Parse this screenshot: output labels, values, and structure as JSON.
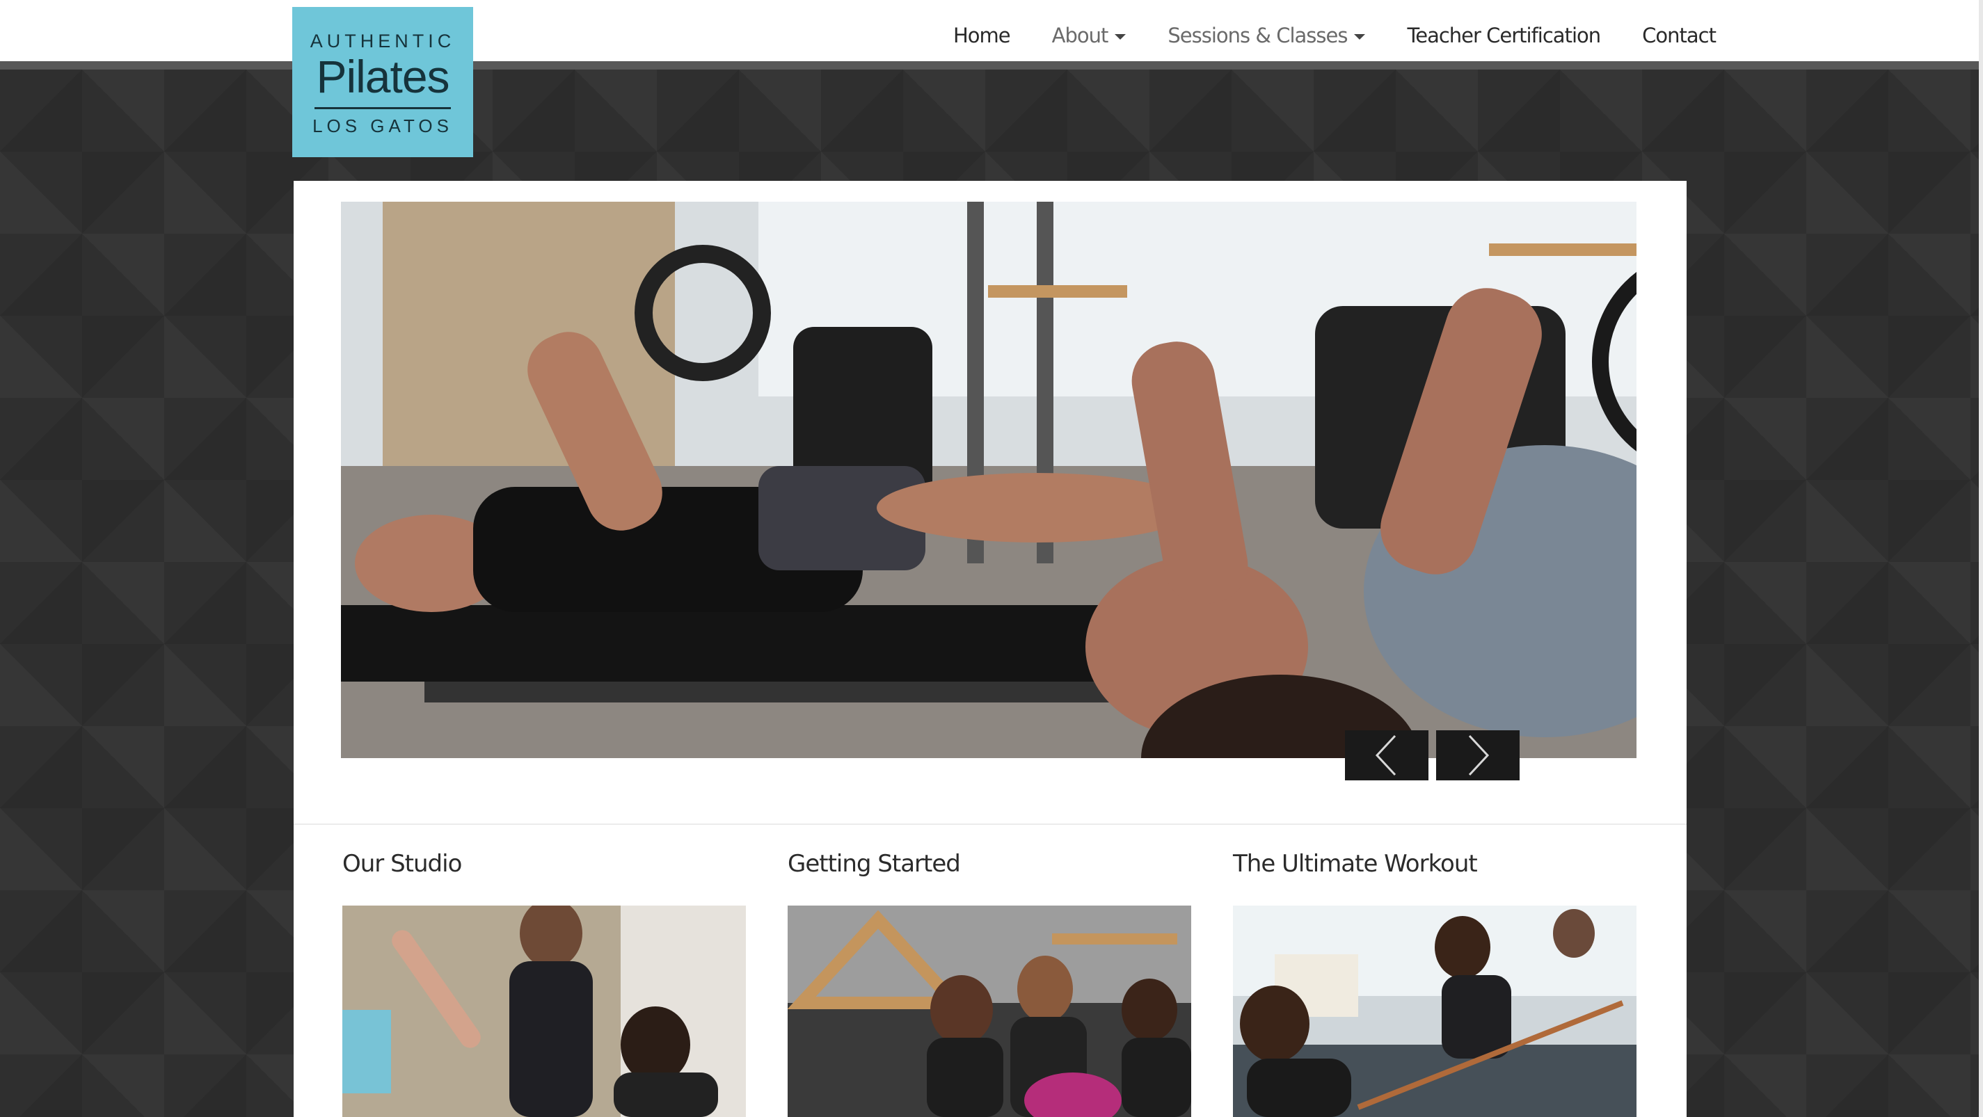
{
  "logo": {
    "line1": "AUTHENTIC",
    "line2": "Pilates",
    "line3": "LOS GATOS",
    "color": "#6fc6d9"
  },
  "nav": {
    "items": [
      {
        "label": "Home",
        "dropdown": false
      },
      {
        "label": "About",
        "dropdown": true
      },
      {
        "label": "Sessions & Classes",
        "dropdown": true
      },
      {
        "label": "Teacher Certification",
        "dropdown": false
      },
      {
        "label": "Contact",
        "dropdown": false
      }
    ]
  },
  "slider": {
    "prev_icon": "chevron-left-icon",
    "next_icon": "chevron-right-icon"
  },
  "sections": [
    {
      "title": "Our Studio"
    },
    {
      "title": "Getting Started"
    },
    {
      "title": "The Ultimate Workout"
    }
  ]
}
